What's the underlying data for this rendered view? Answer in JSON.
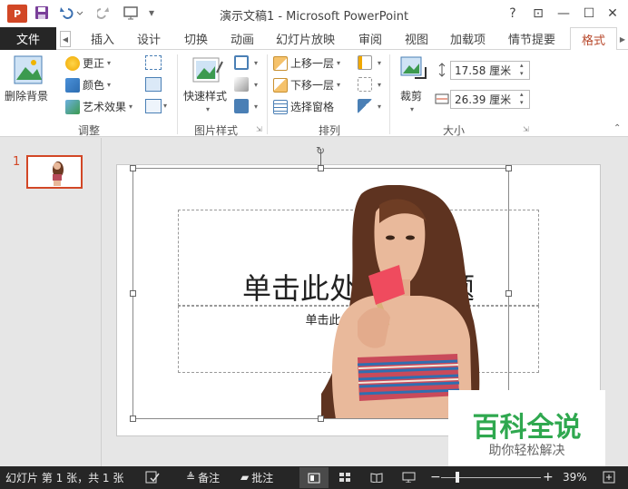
{
  "titlebar": {
    "logo": "P",
    "title": "演示文稿1 - Microsoft PowerPoint",
    "help": "?",
    "win_ribbon": "⊡",
    "win_min": "—",
    "win_max": "☐",
    "win_close": "✕"
  },
  "tabs": {
    "file": "文件",
    "items": [
      "插入",
      "设计",
      "切换",
      "动画",
      "幻灯片放映",
      "审阅",
      "视图",
      "加载项",
      "情节提要"
    ],
    "active": "格式"
  },
  "ribbon": {
    "adjust": {
      "remove_bg": "删除背景",
      "correct": "更正",
      "color": "颜色",
      "art": "艺术效果",
      "label": "调整"
    },
    "style": {
      "quick": "快速样式",
      "label": "图片样式"
    },
    "arrange": {
      "forward": "上移一层",
      "backward": "下移一层",
      "pane": "选择窗格",
      "label": "排列"
    },
    "size": {
      "crop": "裁剪",
      "height": "17.58 厘米",
      "width": "26.39 厘米",
      "label": "大小"
    }
  },
  "slides": {
    "num": "1"
  },
  "slide": {
    "title_placeholder": "单击此处添加标题",
    "subtitle_placeholder": "单击此处添加副标题"
  },
  "watermark": {
    "title": "百科全说",
    "subtitle": "助你轻松解决"
  },
  "status": {
    "slide_info": "幻灯片 第 1 张，共 1 张",
    "notes": "备注",
    "comments": "批注",
    "zoom": "39%",
    "zoom_level": 0.39
  },
  "colors": {
    "accent": "#d24726",
    "format_tab": "#b7472a",
    "statusbar": "#262626",
    "watermark_green": "#2fa84f"
  }
}
